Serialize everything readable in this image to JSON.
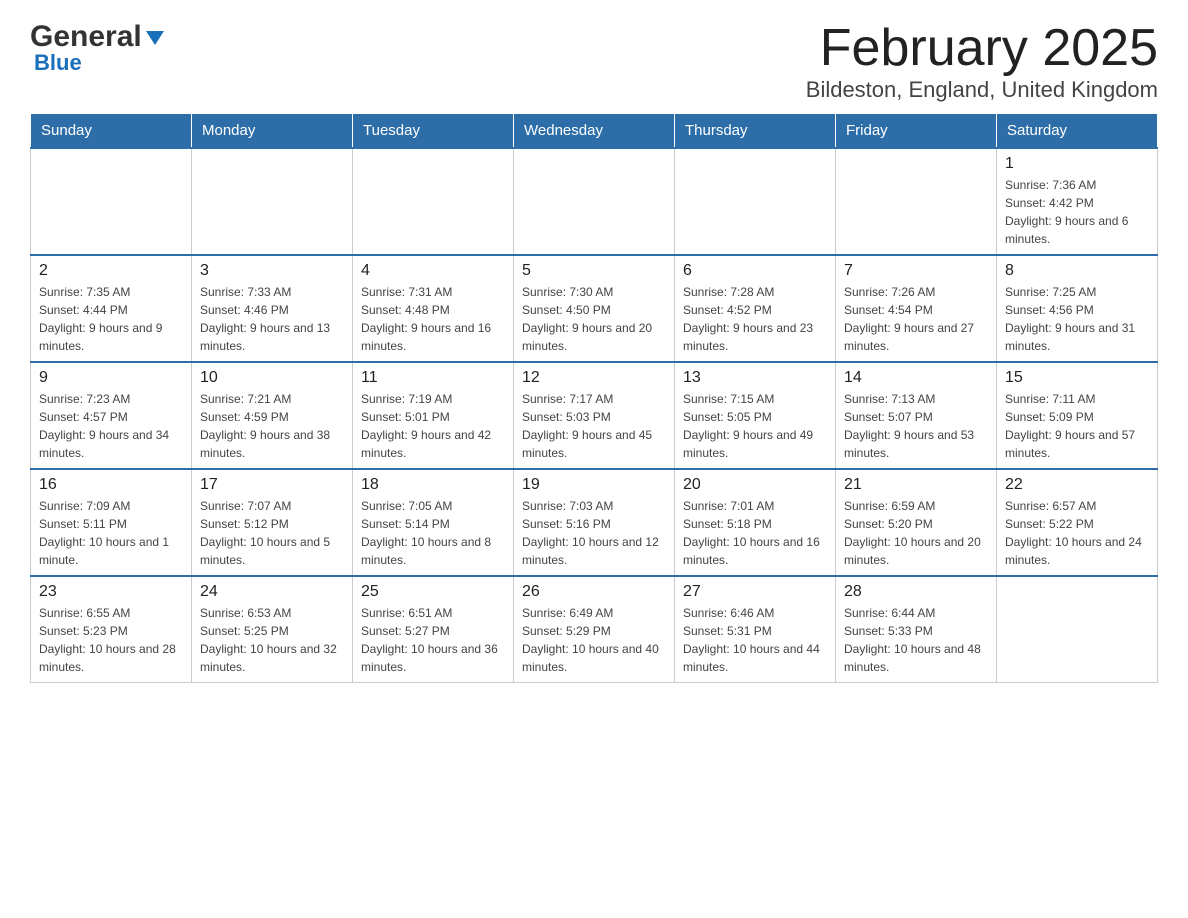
{
  "header": {
    "logo_general": "General",
    "logo_blue": "Blue",
    "title": "February 2025",
    "subtitle": "Bildeston, England, United Kingdom"
  },
  "days_of_week": [
    "Sunday",
    "Monday",
    "Tuesday",
    "Wednesday",
    "Thursday",
    "Friday",
    "Saturday"
  ],
  "weeks": [
    {
      "days": [
        {
          "number": "",
          "info": ""
        },
        {
          "number": "",
          "info": ""
        },
        {
          "number": "",
          "info": ""
        },
        {
          "number": "",
          "info": ""
        },
        {
          "number": "",
          "info": ""
        },
        {
          "number": "",
          "info": ""
        },
        {
          "number": "1",
          "info": "Sunrise: 7:36 AM\nSunset: 4:42 PM\nDaylight: 9 hours and 6 minutes."
        }
      ]
    },
    {
      "days": [
        {
          "number": "2",
          "info": "Sunrise: 7:35 AM\nSunset: 4:44 PM\nDaylight: 9 hours and 9 minutes."
        },
        {
          "number": "3",
          "info": "Sunrise: 7:33 AM\nSunset: 4:46 PM\nDaylight: 9 hours and 13 minutes."
        },
        {
          "number": "4",
          "info": "Sunrise: 7:31 AM\nSunset: 4:48 PM\nDaylight: 9 hours and 16 minutes."
        },
        {
          "number": "5",
          "info": "Sunrise: 7:30 AM\nSunset: 4:50 PM\nDaylight: 9 hours and 20 minutes."
        },
        {
          "number": "6",
          "info": "Sunrise: 7:28 AM\nSunset: 4:52 PM\nDaylight: 9 hours and 23 minutes."
        },
        {
          "number": "7",
          "info": "Sunrise: 7:26 AM\nSunset: 4:54 PM\nDaylight: 9 hours and 27 minutes."
        },
        {
          "number": "8",
          "info": "Sunrise: 7:25 AM\nSunset: 4:56 PM\nDaylight: 9 hours and 31 minutes."
        }
      ]
    },
    {
      "days": [
        {
          "number": "9",
          "info": "Sunrise: 7:23 AM\nSunset: 4:57 PM\nDaylight: 9 hours and 34 minutes."
        },
        {
          "number": "10",
          "info": "Sunrise: 7:21 AM\nSunset: 4:59 PM\nDaylight: 9 hours and 38 minutes."
        },
        {
          "number": "11",
          "info": "Sunrise: 7:19 AM\nSunset: 5:01 PM\nDaylight: 9 hours and 42 minutes."
        },
        {
          "number": "12",
          "info": "Sunrise: 7:17 AM\nSunset: 5:03 PM\nDaylight: 9 hours and 45 minutes."
        },
        {
          "number": "13",
          "info": "Sunrise: 7:15 AM\nSunset: 5:05 PM\nDaylight: 9 hours and 49 minutes."
        },
        {
          "number": "14",
          "info": "Sunrise: 7:13 AM\nSunset: 5:07 PM\nDaylight: 9 hours and 53 minutes."
        },
        {
          "number": "15",
          "info": "Sunrise: 7:11 AM\nSunset: 5:09 PM\nDaylight: 9 hours and 57 minutes."
        }
      ]
    },
    {
      "days": [
        {
          "number": "16",
          "info": "Sunrise: 7:09 AM\nSunset: 5:11 PM\nDaylight: 10 hours and 1 minute."
        },
        {
          "number": "17",
          "info": "Sunrise: 7:07 AM\nSunset: 5:12 PM\nDaylight: 10 hours and 5 minutes."
        },
        {
          "number": "18",
          "info": "Sunrise: 7:05 AM\nSunset: 5:14 PM\nDaylight: 10 hours and 8 minutes."
        },
        {
          "number": "19",
          "info": "Sunrise: 7:03 AM\nSunset: 5:16 PM\nDaylight: 10 hours and 12 minutes."
        },
        {
          "number": "20",
          "info": "Sunrise: 7:01 AM\nSunset: 5:18 PM\nDaylight: 10 hours and 16 minutes."
        },
        {
          "number": "21",
          "info": "Sunrise: 6:59 AM\nSunset: 5:20 PM\nDaylight: 10 hours and 20 minutes."
        },
        {
          "number": "22",
          "info": "Sunrise: 6:57 AM\nSunset: 5:22 PM\nDaylight: 10 hours and 24 minutes."
        }
      ]
    },
    {
      "days": [
        {
          "number": "23",
          "info": "Sunrise: 6:55 AM\nSunset: 5:23 PM\nDaylight: 10 hours and 28 minutes."
        },
        {
          "number": "24",
          "info": "Sunrise: 6:53 AM\nSunset: 5:25 PM\nDaylight: 10 hours and 32 minutes."
        },
        {
          "number": "25",
          "info": "Sunrise: 6:51 AM\nSunset: 5:27 PM\nDaylight: 10 hours and 36 minutes."
        },
        {
          "number": "26",
          "info": "Sunrise: 6:49 AM\nSunset: 5:29 PM\nDaylight: 10 hours and 40 minutes."
        },
        {
          "number": "27",
          "info": "Sunrise: 6:46 AM\nSunset: 5:31 PM\nDaylight: 10 hours and 44 minutes."
        },
        {
          "number": "28",
          "info": "Sunrise: 6:44 AM\nSunset: 5:33 PM\nDaylight: 10 hours and 48 minutes."
        },
        {
          "number": "",
          "info": ""
        }
      ]
    }
  ]
}
